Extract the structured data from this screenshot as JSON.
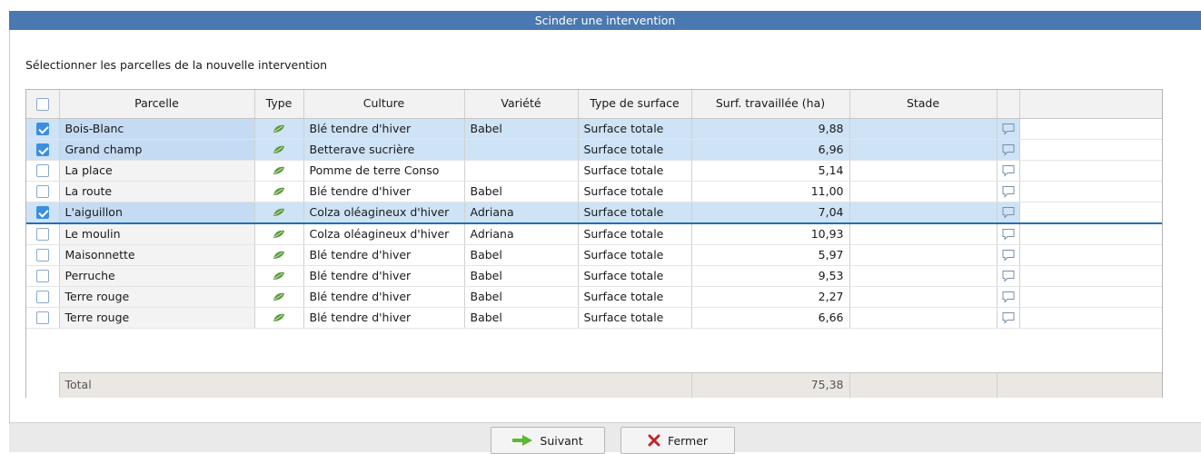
{
  "window": {
    "title": "Scinder une intervention"
  },
  "instruction": "Sélectionner les parcelles de la nouvelle intervention",
  "columns": [
    "Parcelle",
    "Type",
    "Culture",
    "Variété",
    "Type de surface",
    "Surf. travaillée (ha)",
    "Stade",
    ""
  ],
  "rows": [
    {
      "checked": true,
      "parcelle": "Bois-Blanc",
      "culture": "Blé tendre d'hiver",
      "variete": "Babel",
      "surface_type": "Surface totale",
      "surface": "9,88",
      "stade": ""
    },
    {
      "checked": true,
      "parcelle": "Grand champ",
      "culture": "Betterave sucrière",
      "variete": "",
      "surface_type": "Surface totale",
      "surface": "6,96",
      "stade": ""
    },
    {
      "checked": false,
      "parcelle": "La place",
      "culture": "Pomme de terre Conso",
      "variete": "",
      "surface_type": "Surface totale",
      "surface": "5,14",
      "stade": ""
    },
    {
      "checked": false,
      "parcelle": "La route",
      "culture": "Blé tendre d'hiver",
      "variete": "Babel",
      "surface_type": "Surface totale",
      "surface": "11,00",
      "stade": ""
    },
    {
      "checked": true,
      "parcelle": "L'aiguillon",
      "culture": "Colza oléagineux d'hiver",
      "variete": "Adriana",
      "surface_type": "Surface totale",
      "surface": "7,04",
      "stade": ""
    },
    {
      "checked": false,
      "parcelle": "Le moulin",
      "culture": "Colza oléagineux d'hiver",
      "variete": "Adriana",
      "surface_type": "Surface totale",
      "surface": "10,93",
      "stade": ""
    },
    {
      "checked": false,
      "parcelle": "Maisonnette",
      "culture": "Blé tendre d'hiver",
      "variete": "Babel",
      "surface_type": "Surface totale",
      "surface": "5,97",
      "stade": ""
    },
    {
      "checked": false,
      "parcelle": "Perruche",
      "culture": "Blé tendre d'hiver",
      "variete": "Babel",
      "surface_type": "Surface totale",
      "surface": "9,53",
      "stade": ""
    },
    {
      "checked": false,
      "parcelle": "Terre rouge",
      "culture": "Blé tendre d'hiver",
      "variete": "Babel",
      "surface_type": "Surface totale",
      "surface": "2,27",
      "stade": ""
    },
    {
      "checked": false,
      "parcelle": "Terre rouge",
      "culture": "Blé tendre d'hiver",
      "variete": "Babel",
      "surface_type": "Surface totale",
      "surface": "6,66",
      "stade": ""
    }
  ],
  "total": {
    "label": "Total",
    "value": "75,38"
  },
  "buttons": {
    "next": "Suivant",
    "close": "Fermer"
  },
  "colors": {
    "titlebar": "#4a78b0",
    "selected_row": "#cfe3f6",
    "checkbox_checked": "#3b8fe0",
    "leaf_icon": "#5a9a3a",
    "next_arrow": "#5cb82c",
    "close_x": "#c0282d"
  },
  "icons": {
    "type": "leaf-icon",
    "comment": "comment-icon",
    "next": "arrow-right-icon",
    "close": "close-x-icon"
  }
}
